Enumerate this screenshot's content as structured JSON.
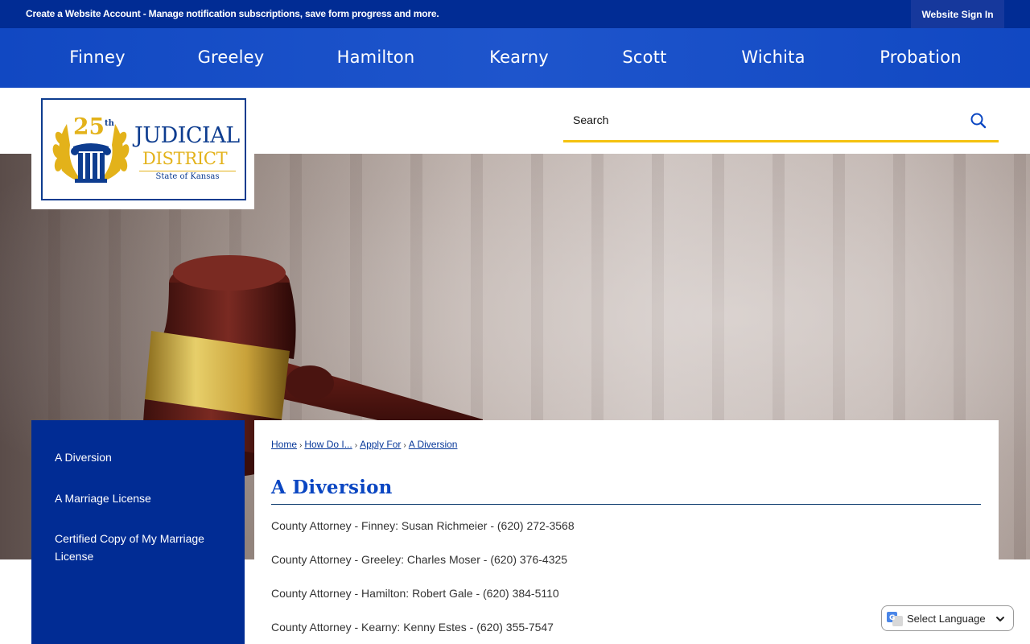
{
  "topbar": {
    "account_link": "Create a Website Account",
    "account_text": " - Manage notification subscriptions, save form progress and more.",
    "signin": "Website Sign In"
  },
  "nav": {
    "items": [
      {
        "label": "Finney"
      },
      {
        "label": "Greeley"
      },
      {
        "label": "Hamilton"
      },
      {
        "label": "Kearny"
      },
      {
        "label": "Scott"
      },
      {
        "label": "Wichita"
      },
      {
        "label": "Probation"
      }
    ]
  },
  "logo": {
    "number": "25",
    "suffix": "th",
    "line1": "JUDICIAL",
    "line2": "DISTRICT",
    "line3": "State of Kansas"
  },
  "search": {
    "placeholder": "Search"
  },
  "sidenav": {
    "items": [
      {
        "label": "A Diversion"
      },
      {
        "label": "A Marriage License"
      },
      {
        "label": "Certified Copy of My Marriage License"
      }
    ]
  },
  "breadcrumb": {
    "items": [
      {
        "label": "Home"
      },
      {
        "label": "How Do I..."
      },
      {
        "label": "Apply For"
      },
      {
        "label": "A Diversion"
      }
    ]
  },
  "page": {
    "title": "A Diversion",
    "attorneys": [
      "County Attorney - Finney: Susan Richmeier - (620) 272-3568",
      "County Attorney - Greeley: Charles Moser - (620) 376-4325",
      "County Attorney - Hamilton: Robert Gale - (620) 384-5110",
      "County Attorney - Kearny: Kenny Estes - (620) 355-7547"
    ]
  },
  "translate": {
    "label": "Select Language"
  },
  "colors": {
    "topbar": "#012c94",
    "nav": "#1148c2",
    "accent_gold": "#f4c20f",
    "title_blue": "#0a46c2",
    "logo_navy": "#0d3c8f"
  }
}
